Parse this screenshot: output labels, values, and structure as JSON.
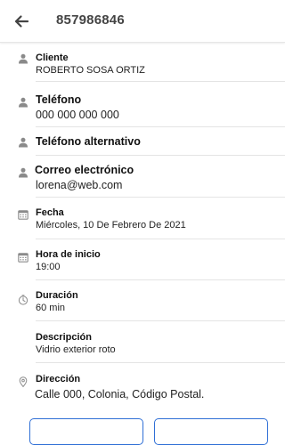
{
  "header": {
    "back_icon": "arrow-left-icon",
    "title": "857986846"
  },
  "details": {
    "cliente": {
      "label": "Cliente",
      "value": "ROBERTO SOSA ORTIZ",
      "icon": "person-icon"
    },
    "telefono": {
      "label": "Teléfono",
      "value": "000 000 000 000",
      "icon": "person-icon"
    },
    "telefono_alt": {
      "label": "Teléfono alternativo",
      "value": "",
      "icon": "person-icon"
    },
    "correo": {
      "label": "Correo electrónico",
      "value": "lorena@web.com",
      "icon": "person-icon"
    },
    "fecha": {
      "label": "Fecha",
      "value": "Miércoles, 10 De Febrero De 2021",
      "icon": "calendar-icon"
    },
    "hora": {
      "label": "Hora de inicio",
      "value": "19:00",
      "icon": "calendar-icon"
    },
    "duracion": {
      "label": "Duración",
      "value": "60 min",
      "icon": "timer-icon"
    },
    "descripcion": {
      "label": "Descripción",
      "value": "Vidrio exterior roto"
    },
    "direccion": {
      "label": "Dirección",
      "value": "Calle 000, Colonia, Código Postal.",
      "icon": "location-pin-icon"
    }
  },
  "colors": {
    "accent": "#2f6fd6",
    "icon_gray": "#8a8a8a",
    "divider": "#e4e4e4"
  }
}
